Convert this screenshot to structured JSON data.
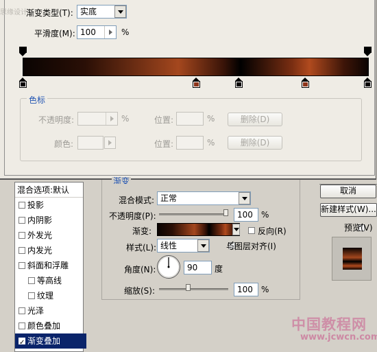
{
  "editor": {
    "watermark": "思缘设计",
    "gradient_type_label": "渐变类型(T):",
    "gradient_type_value": "实底",
    "smoothness_label": "平滑度(M):",
    "smoothness_value": "100",
    "percent": "%",
    "color_stops_title": "色标",
    "opacity_label": "不透明度:",
    "opacity_percent": "%",
    "location_label_1": "位置:",
    "location_percent_1": "%",
    "delete_label_1": "删除(D)",
    "color_label": "颜色:",
    "location_label_2": "位置:",
    "location_percent_2": "%",
    "delete_label_2": "删除(D)",
    "stop_colors": [
      "#0a0402",
      "#8e351a",
      "#0a0402",
      "#8e351a",
      "#0a0402"
    ]
  },
  "style_list": {
    "header": "混合选项:默认",
    "items": [
      {
        "label": "投影",
        "checked": false
      },
      {
        "label": "内阴影",
        "checked": false
      },
      {
        "label": "外发光",
        "checked": false
      },
      {
        "label": "内发光",
        "checked": false
      },
      {
        "label": "斜面和浮雕",
        "checked": false
      },
      {
        "label": "等高线",
        "checked": false
      },
      {
        "label": "纹理",
        "checked": false
      },
      {
        "label": "光泽",
        "checked": false
      },
      {
        "label": "颜色叠加",
        "checked": false
      },
      {
        "label": "渐变叠加",
        "checked": true
      }
    ]
  },
  "gradient_overlay": {
    "group_title": "渐变",
    "blend_mode_label": "混合模式:",
    "blend_mode_value": "正常",
    "opacity_label": "不透明度(P):",
    "opacity_value": "100",
    "opacity_unit": "%",
    "opacity_level": 1.0,
    "gradient_label": "渐变:",
    "reverse_label": "反向(R)",
    "reverse_checked": false,
    "style_label": "样式(L):",
    "style_value": "线性",
    "align_label": "与图层对齐(I)",
    "align_checked": true,
    "angle_label": "角度(N):",
    "angle_value": "90",
    "angle_unit": "度",
    "scale_label": "缩放(S):",
    "scale_value": "100",
    "scale_unit": "%",
    "scale_level": 0.42
  },
  "buttons": {
    "cancel": "取消",
    "new_style": "新建样式(W)...",
    "preview_label": "预览(V)",
    "preview_checked": true
  },
  "watermark_bottom": {
    "cn": "中国教程网",
    "url": "www.jcwcn.com"
  }
}
